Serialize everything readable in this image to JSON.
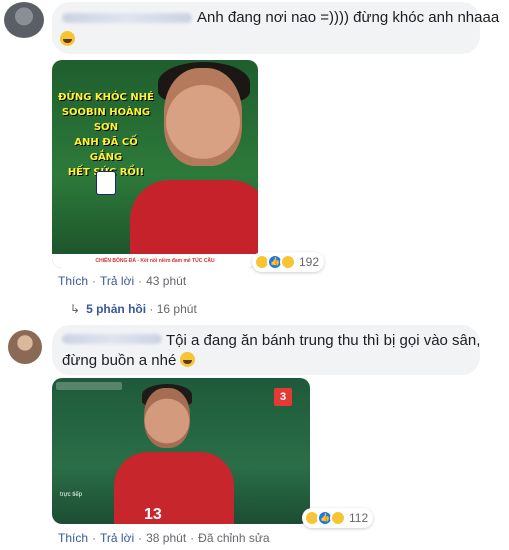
{
  "comment1": {
    "text": "Anh đang nơi nao =)))) đừng khóc anh nhaaa",
    "emoji": "haha-emoji",
    "image": {
      "caption_lines": [
        "ĐỪNG KHÓC NHÉ",
        "SOOBIN HOÀNG SƠN",
        "ANH ĐÃ CỐ GẮNG",
        "HẾT SỨC RỒI!"
      ],
      "footer": "CHIẾN BÓNG ĐÁ - Kết nối niềm đam mê TÚC CẦU"
    },
    "reactions": {
      "icons": [
        "haha-icon",
        "like-icon",
        "sad-icon"
      ],
      "count": "192"
    },
    "actions": {
      "like": "Thích",
      "reply": "Trả lời",
      "time": "43 phút"
    },
    "replies": {
      "label": "5 phản hồi",
      "time": "16 phút"
    }
  },
  "comment2": {
    "text_line1": "Tội a đang ăn bánh trung thu thì bị gọi vào sân,",
    "text_line2": "đừng buồn a nhé",
    "emoji": "haha-emoji",
    "image": {
      "tv_logo": "3",
      "live_label": "trực tiếp",
      "shirt_number": "13"
    },
    "reactions": {
      "icons": [
        "haha-icon",
        "like-icon",
        "sad-icon"
      ],
      "count": "112"
    },
    "actions": {
      "like": "Thích",
      "reply": "Trả lời",
      "time": "38 phút",
      "edited": "Đã chỉnh sửa"
    }
  },
  "colors": {
    "bubble": "#f2f3f5",
    "link": "#385898",
    "meta": "#65676b",
    "like_blue": "#1877f2",
    "haha_yellow": "#f7c533"
  }
}
